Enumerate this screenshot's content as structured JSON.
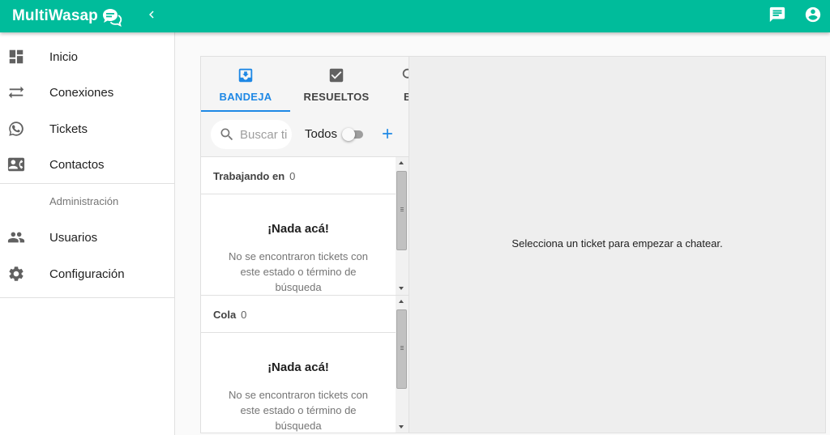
{
  "app": {
    "name": "MultiWasap"
  },
  "colors": {
    "primary": "#00bc9b",
    "accent": "#1e88e5"
  },
  "header": {
    "icons": [
      "chat-icon",
      "account-icon"
    ]
  },
  "sidebar": {
    "items": [
      {
        "label": "Inicio",
        "icon": "dashboard-icon"
      },
      {
        "label": "Conexiones",
        "icon": "sync-alt-icon"
      },
      {
        "label": "Tickets",
        "icon": "whatsapp-icon"
      },
      {
        "label": "Contactos",
        "icon": "contact-card-icon"
      }
    ],
    "section_title": "Administración",
    "admin_items": [
      {
        "label": "Usuarios",
        "icon": "people-icon"
      },
      {
        "label": "Configuración",
        "icon": "settings-icon"
      }
    ]
  },
  "tickets": {
    "tabs": [
      {
        "label": "BANDEJA",
        "icon": "inbox-icon",
        "active": true
      },
      {
        "label": "RESUELTOS",
        "icon": "check-box-icon",
        "active": false
      },
      {
        "label": "B",
        "icon": "search-icon",
        "active": false
      }
    ],
    "search": {
      "placeholder": "Buscar ti"
    },
    "toggle_label": "Todos",
    "queues": [
      {
        "title": "Trabajando en",
        "count": "0",
        "empty_title": "¡Nada acá!",
        "empty_text": "No se encontraron tickets con este estado o término de búsqueda"
      },
      {
        "title": "Cola",
        "count": "0",
        "empty_title": "¡Nada acá!",
        "empty_text": "No se encontraron tickets con este estado o término de búsqueda"
      }
    ]
  },
  "chat": {
    "placeholder": "Selecciona un ticket para empezar a chatear."
  }
}
